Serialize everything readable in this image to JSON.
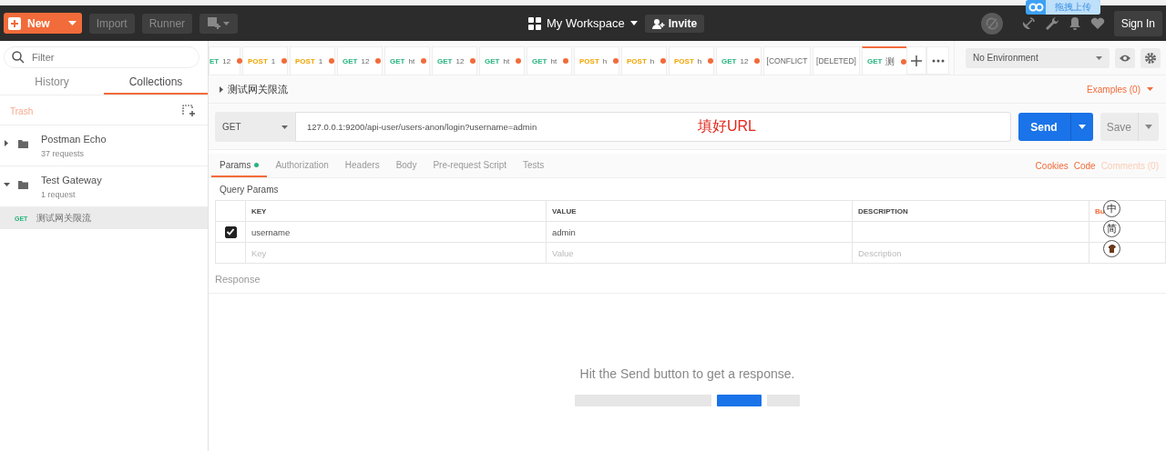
{
  "header": {
    "new_button": "New",
    "import_button": "Import",
    "runner_button": "Runner",
    "workspace": "My Workspace",
    "invite_button": "Invite",
    "sign_in_button": "Sign In",
    "upload_badge": "拖拽上传"
  },
  "sidebar": {
    "filter_placeholder": "Filter",
    "tabs": [
      {
        "label": "History",
        "selected": false
      },
      {
        "label": "Collections",
        "selected": true
      }
    ],
    "trash": "Trash",
    "collections": [
      {
        "name": "Postman Echo",
        "count": "37 requests",
        "expanded": false
      },
      {
        "name": "Test Gateway",
        "count": "1 request",
        "expanded": true,
        "children": [
          {
            "method": "GET",
            "name": "测试网关限流",
            "selected": true
          }
        ]
      }
    ]
  },
  "tabs": [
    {
      "kind": "get",
      "method": "ET",
      "name": "12",
      "unsaved": true,
      "selected": false
    },
    {
      "kind": "post",
      "method": "POST",
      "name": "1",
      "unsaved": true,
      "selected": false
    },
    {
      "kind": "post",
      "method": "POST",
      "name": "1",
      "unsaved": true,
      "selected": false
    },
    {
      "kind": "get",
      "method": "GET",
      "name": "12",
      "unsaved": true,
      "selected": false
    },
    {
      "kind": "get",
      "method": "GET",
      "name": "ht",
      "unsaved": true,
      "selected": false
    },
    {
      "kind": "get",
      "method": "GET",
      "name": "12",
      "unsaved": true,
      "selected": false
    },
    {
      "kind": "get",
      "method": "GET",
      "name": "ht",
      "unsaved": true,
      "selected": false
    },
    {
      "kind": "get",
      "method": "GET",
      "name": "ht",
      "unsaved": true,
      "selected": false
    },
    {
      "kind": "post",
      "method": "POST",
      "name": "h",
      "unsaved": true,
      "selected": false
    },
    {
      "kind": "post",
      "method": "POST",
      "name": "h",
      "unsaved": true,
      "selected": false
    },
    {
      "kind": "post",
      "method": "POST",
      "name": "h",
      "unsaved": true,
      "selected": false
    },
    {
      "kind": "get",
      "method": "GET",
      "name": "12",
      "unsaved": true,
      "selected": false
    },
    {
      "kind": "plain",
      "name": "[CONFLICT",
      "unsaved": false,
      "selected": false
    },
    {
      "kind": "plain",
      "name": "[DELETED]",
      "unsaved": false,
      "selected": false
    },
    {
      "kind": "get",
      "method": "GET",
      "name": "测",
      "unsaved": true,
      "selected": true
    }
  ],
  "environment": "No Environment",
  "request": {
    "title": "测试网关限流",
    "examples": "Examples (0)",
    "method": "GET",
    "url": "127.0.0.1:9200/api-user/users-anon/login?username=admin",
    "annotation": "填好URL",
    "send_button": "Send",
    "save_button": "Save",
    "tabs": [
      {
        "label": "Params",
        "selected": true,
        "dot": true
      },
      {
        "label": "Authorization",
        "selected": false,
        "dot": false
      },
      {
        "label": "Headers",
        "selected": false,
        "dot": false
      },
      {
        "label": "Body",
        "selected": false,
        "dot": false
      },
      {
        "label": "Pre-request Script",
        "selected": false,
        "dot": false
      },
      {
        "label": "Tests",
        "selected": false,
        "dot": false
      }
    ],
    "links": [
      {
        "label": "Cookies",
        "disabled": false
      },
      {
        "label": "Code",
        "disabled": false
      },
      {
        "label": "Comments (0)",
        "disabled": true
      }
    ],
    "query_params": {
      "title": "Query Params",
      "columns": [
        "KEY",
        "VALUE",
        "DESCRIPTION"
      ],
      "bulk_edit": "Bu",
      "rows": [
        {
          "checked": true,
          "key": "username",
          "value": "admin"
        }
      ],
      "placeholders": {
        "key": "Key",
        "value": "Value",
        "description": "Description"
      }
    }
  },
  "response": {
    "title": "Response",
    "hint": "Hit the Send button to get a response."
  },
  "ime": [
    "中",
    "简"
  ]
}
